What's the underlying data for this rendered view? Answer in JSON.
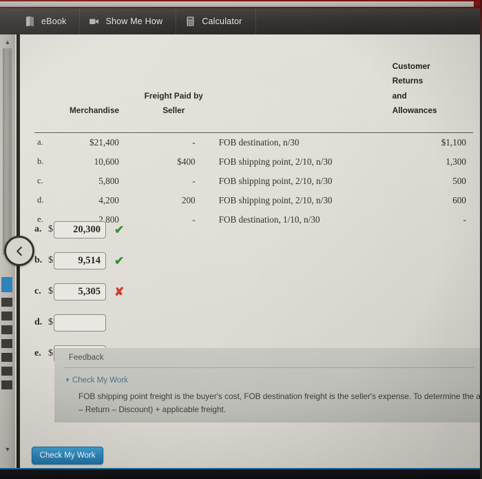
{
  "tabs": [
    {
      "label": "eBook",
      "icon": "book-icon"
    },
    {
      "label": "Show Me How",
      "icon": "video-icon"
    },
    {
      "label": "Calculator",
      "icon": "calculator-icon"
    }
  ],
  "table": {
    "headers": {
      "merchandise": "Merchandise",
      "freight_line1": "Freight Paid by",
      "freight_line2": "Seller",
      "terms": "",
      "returns_line1": "Customer",
      "returns_line2": "Returns",
      "returns_line3": "and",
      "returns_line4": "Allowances"
    },
    "rows": [
      {
        "letter": "a.",
        "merchandise": "$21,400",
        "freight": "-",
        "terms": "FOB destination, n/30",
        "returns": "$1,100"
      },
      {
        "letter": "b.",
        "merchandise": "10,600",
        "freight": "$400",
        "terms": "FOB shipping point, 2/10, n/30",
        "returns": "1,300"
      },
      {
        "letter": "c.",
        "merchandise": "5,800",
        "freight": "-",
        "terms": "FOB shipping point, 2/10, n/30",
        "returns": "500"
      },
      {
        "letter": "d.",
        "merchandise": "4,200",
        "freight": "200",
        "terms": "FOB shipping point, 2/10, n/30",
        "returns": "600"
      },
      {
        "letter": "e.",
        "merchandise": "2,800",
        "freight": "-",
        "terms": "FOB destination, 1/10, n/30",
        "returns": "-"
      }
    ]
  },
  "answers": {
    "currency_symbol": "$",
    "rows": [
      {
        "letter": "a.",
        "value": "20,300",
        "mark": "✔",
        "status": "correct"
      },
      {
        "letter": "b.",
        "value": "9,514",
        "mark": "✔",
        "status": "correct"
      },
      {
        "letter": "c.",
        "value": "5,305",
        "mark": "✘",
        "status": "incorrect"
      },
      {
        "letter": "d.",
        "value": "",
        "mark": "",
        "status": "empty"
      },
      {
        "letter": "e.",
        "value": "",
        "mark": "",
        "status": "empty"
      }
    ]
  },
  "feedback": {
    "title": "Feedback",
    "check_my_work_label": "Check My Work",
    "triangle": "▼",
    "body_line1": "FOB shipping point freight is the buyer's cost, FOB destination freight is the seller's expense. To determine the amou",
    "body_line2": "– Return – Discount) + applicable freight."
  },
  "buttons": {
    "check_my_work": "Check My Work",
    "back": "‹"
  },
  "colors": {
    "accent_blue": "#2b86bb",
    "correct_green": "#2d8b2d",
    "incorrect_red": "#cb3526",
    "tabbar_dark": "#343330",
    "top_band_red": "#8e1a16"
  }
}
